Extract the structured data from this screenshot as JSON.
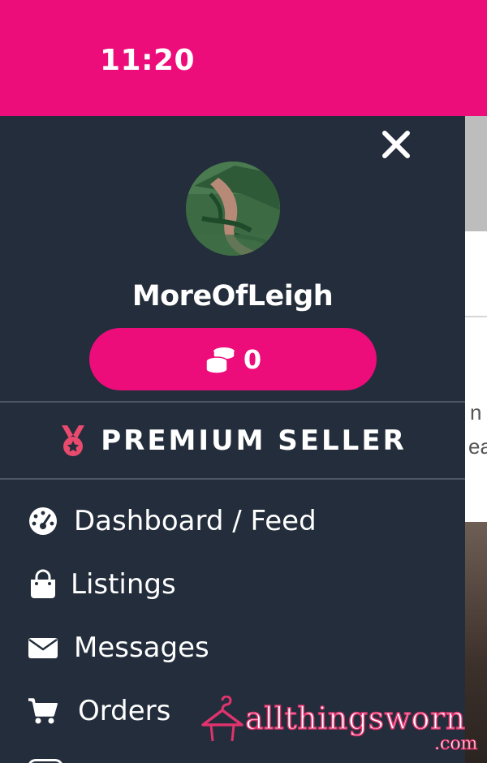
{
  "status_bar": {
    "time": "11:20"
  },
  "drawer": {
    "username": "MoreOfLeigh",
    "coins": {
      "count": "0",
      "icon": "coins-icon"
    },
    "badge": {
      "label": "PREMIUM SELLER",
      "icon": "medal-icon"
    },
    "menu": [
      {
        "label": "Dashboard / Feed",
        "icon": "tachometer-icon"
      },
      {
        "label": "Listings",
        "icon": "shopping-bag-icon"
      },
      {
        "label": "Messages",
        "icon": "envelope-icon"
      },
      {
        "label": "Orders",
        "icon": "shopping-cart-icon"
      }
    ]
  },
  "background_page": {
    "text_line_1": "n",
    "text_line_2": "ea"
  },
  "watermark": {
    "brand": "allthingsworn",
    "domain": ".com"
  },
  "colors": {
    "accent": "#ec0c7a",
    "drawer_bg": "#232d3b",
    "medal": "#e94a6e"
  }
}
